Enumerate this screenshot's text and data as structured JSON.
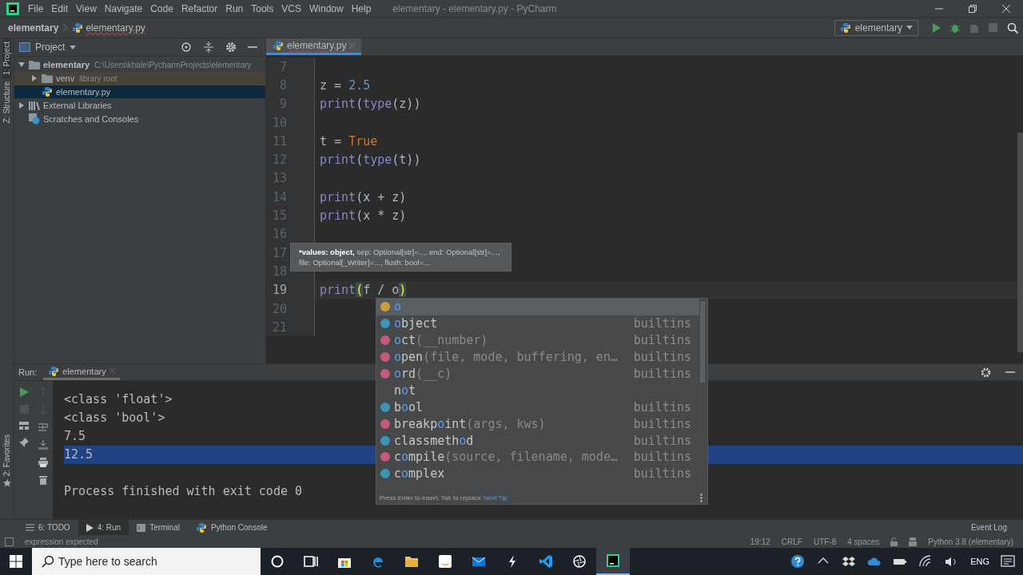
{
  "menu_bar": {
    "items": [
      "File",
      "Edit",
      "View",
      "Navigate",
      "Code",
      "Refactor",
      "Run",
      "Tools",
      "VCS",
      "Window",
      "Help"
    ],
    "title": "elementary - elementary.py - PyCharm"
  },
  "navigation_bar": {
    "breadcrumbs": [
      "elementary",
      "elementary.py"
    ],
    "run_configuration": "elementary"
  },
  "side_stripe": {
    "top_tabs": [
      {
        "label": "1: Project",
        "selected": true
      },
      {
        "label": "Z: Structure",
        "selected": false
      }
    ],
    "bottom_tabs": [
      {
        "label": "2: Favorites",
        "selected": false
      }
    ]
  },
  "project_panel": {
    "title": "Project",
    "tree": [
      {
        "label": "elementary",
        "hint": "C:\\Users\\khale\\PycharmProjects\\elementary",
        "kind": "folder",
        "expanded": true,
        "selected": false,
        "children": [
          {
            "label": "venv",
            "hint": "library root",
            "kind": "library_root",
            "expanded": false,
            "selected": false
          },
          {
            "label": "elementary.py",
            "kind": "python",
            "selected": true
          }
        ]
      },
      {
        "label": "External Libraries",
        "kind": "library",
        "expanded": false,
        "selected": false
      },
      {
        "label": "Scratches and Consoles",
        "kind": "scratch",
        "selected": false
      }
    ]
  },
  "editor": {
    "tabs": [
      {
        "label": "elementary.py",
        "selected": true
      }
    ],
    "lines": [
      {
        "number": "7",
        "current": false
      },
      {
        "number": "8",
        "current": false,
        "tokens": [
          {
            "text": "z = ",
            "kind": "plain"
          },
          {
            "text": "2.5",
            "kind": "number"
          }
        ]
      },
      {
        "number": "9",
        "current": false,
        "tokens": [
          {
            "text": "print",
            "kind": "builtin"
          },
          {
            "text": "(",
            "kind": "plain"
          },
          {
            "text": "type",
            "kind": "builtin"
          },
          {
            "text": "(z))",
            "kind": "plain"
          }
        ]
      },
      {
        "number": "10",
        "current": false
      },
      {
        "number": "11",
        "current": false,
        "tokens": [
          {
            "text": "t = ",
            "kind": "plain"
          },
          {
            "text": "True",
            "kind": "keyword"
          }
        ]
      },
      {
        "number": "12",
        "current": false,
        "tokens": [
          {
            "text": "print",
            "kind": "builtin"
          },
          {
            "text": "(",
            "kind": "plain"
          },
          {
            "text": "type",
            "kind": "builtin"
          },
          {
            "text": "(t))",
            "kind": "plain"
          }
        ]
      },
      {
        "number": "13",
        "current": false
      },
      {
        "number": "14",
        "current": false,
        "tokens": [
          {
            "text": "print",
            "kind": "builtin"
          },
          {
            "text": "(x + z)",
            "kind": "plain"
          }
        ]
      },
      {
        "number": "15",
        "current": false,
        "tokens": [
          {
            "text": "print",
            "kind": "builtin"
          },
          {
            "text": "(x * z)",
            "kind": "plain"
          }
        ]
      },
      {
        "number": "16",
        "current": false
      },
      {
        "number": "17",
        "current": false
      },
      {
        "number": "18",
        "current": false
      },
      {
        "number": "19",
        "current": true,
        "tokens": [
          {
            "text": "print",
            "kind": "builtin"
          },
          {
            "text": "(",
            "kind": "brace_match"
          },
          {
            "text": "f / o",
            "kind": "plain"
          },
          {
            "text": ")",
            "kind": "brace_match"
          }
        ]
      },
      {
        "number": "20",
        "current": false
      },
      {
        "number": "21",
        "current": false
      }
    ]
  },
  "parameter_hint": {
    "emphasis": "*values: object,",
    "text": "sep: Optional[str]=..., end: Optional[str]=..., file: Optional[_Writer]=..., flush: bool=..."
  },
  "completion": {
    "items": [
      {
        "kind": "variable",
        "match": "o",
        "selected": true
      },
      {
        "kind": "class",
        "match": "o",
        "rest": "bject",
        "source": "builtins",
        "selected": false
      },
      {
        "kind": "function",
        "match": "o",
        "rest": "ct",
        "params": "(__number)",
        "source": "builtins",
        "selected": false
      },
      {
        "kind": "function",
        "match": "o",
        "rest": "pen",
        "params": "(file, mode, buffering, en…",
        "source": "builtins",
        "selected": false
      },
      {
        "kind": "function",
        "match": "o",
        "rest": "rd",
        "params": "(__c)",
        "source": "builtins",
        "selected": false
      },
      {
        "kind": "keyword",
        "before": "n",
        "match": "o",
        "rest": "t",
        "selected": false
      },
      {
        "kind": "class",
        "before": "b",
        "match": "o",
        "rest": "ol",
        "source": "builtins",
        "selected": false
      },
      {
        "kind": "function",
        "before": "breakp",
        "match": "o",
        "rest": "int",
        "params": "(args, kws)",
        "source": "builtins",
        "selected": false
      },
      {
        "kind": "class",
        "before": "classmeth",
        "match": "o",
        "rest": "d",
        "source": "builtins",
        "selected": false
      },
      {
        "kind": "function",
        "before": "c",
        "match": "o",
        "rest": "mpile",
        "params": "(source, filename, mode…",
        "source": "builtins",
        "selected": false
      },
      {
        "kind": "class",
        "before": "c",
        "match": "o",
        "rest": "mplex",
        "source": "builtins",
        "selected": false
      }
    ],
    "footer_text": "Press Enter to insert, Tab to replace",
    "footer_link": "Next Tip"
  },
  "run_panel": {
    "label": "Run:",
    "tabs": [
      {
        "label": "elementary",
        "selected": true
      }
    ],
    "console": [
      {
        "text": "<class 'float'>",
        "kind": "output",
        "selected": false
      },
      {
        "text": "<class 'bool'>",
        "kind": "output",
        "selected": false
      },
      {
        "text": "7.5",
        "kind": "output",
        "selected": false
      },
      {
        "text": "12.5",
        "kind": "output",
        "selected": true
      },
      {
        "text": "Process finished with exit code 0",
        "kind": "status",
        "selected": false
      }
    ]
  },
  "tool_window_bar": {
    "tabs": [
      {
        "label": "6: TODO",
        "selected": false
      },
      {
        "label": "4: Run",
        "selected": true
      },
      {
        "label": "Terminal",
        "selected": false
      },
      {
        "label": "Python Console",
        "selected": false
      }
    ],
    "event_log": "Event Log"
  },
  "status_bar": {
    "message": "expression expected",
    "items": [
      "19:12",
      "CRLF",
      "UTF-8",
      "4 spaces"
    ],
    "interpreter": "Python 3.8 (elementary)"
  },
  "taskbar": {
    "search_placeholder": "Type here to search",
    "language": "ENG"
  }
}
